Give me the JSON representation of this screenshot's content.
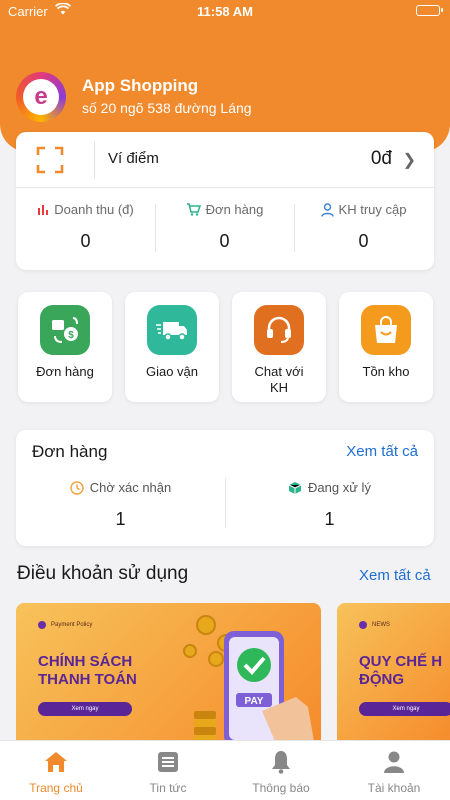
{
  "status_bar": {
    "carrier": "Carrier",
    "time": "11:58 AM"
  },
  "store": {
    "name": "App Shopping",
    "address": "số 20 ngõ 538 đường Láng"
  },
  "wallet": {
    "label": "Ví điểm",
    "value": "0đ"
  },
  "stats": [
    {
      "label": "Doanh thu (đ)",
      "value": "0",
      "icon": "bar-chart-icon"
    },
    {
      "label": "Đơn hàng",
      "value": "0",
      "icon": "cart-icon"
    },
    {
      "label": "KH truy cập",
      "value": "0",
      "icon": "user-icon"
    }
  ],
  "shortcuts": [
    {
      "label": "Đơn hàng",
      "icon": "order-exchange-icon",
      "color": "#3aa65a"
    },
    {
      "label": "Giao vận",
      "icon": "delivery-truck-icon",
      "color": "#2fb89a"
    },
    {
      "label": "Chat với KH",
      "icon": "headset-icon",
      "color": "#e0701f"
    },
    {
      "label": "Tồn kho",
      "icon": "shopping-bag-icon",
      "color": "#f49a1d"
    }
  ],
  "orders": {
    "title": "Đơn hàng",
    "see_all": "Xem tất cả",
    "items": [
      {
        "label": "Chờ xác nhận",
        "value": "1",
        "icon": "clock-icon"
      },
      {
        "label": "Đang xử lý",
        "value": "1",
        "icon": "box-icon"
      }
    ]
  },
  "terms": {
    "title": "Điều khoản sử dụng",
    "see_all": "Xem tất cả",
    "banners": [
      {
        "tag": "Payment Policy",
        "heading_line1": "CHÍNH SÁCH",
        "heading_line2": "THANH TOÁN",
        "button": "Xem ngay",
        "pay_label": "PAY"
      },
      {
        "tag": "NEWS",
        "heading_line1": "QUY CHẾ H",
        "heading_line2": "ĐỘNG",
        "button": "Xem ngay"
      }
    ]
  },
  "tabs": [
    {
      "label": "Trang chủ",
      "icon": "home-icon",
      "active": true
    },
    {
      "label": "Tin tức",
      "icon": "news-icon",
      "active": false
    },
    {
      "label": "Thông báo",
      "icon": "bell-icon",
      "active": false
    },
    {
      "label": "Tài khoản",
      "icon": "account-icon",
      "active": false
    }
  ],
  "colors": {
    "brand": "#f08a2c",
    "link": "#1e6fd0",
    "banner_text": "#5a2596"
  }
}
